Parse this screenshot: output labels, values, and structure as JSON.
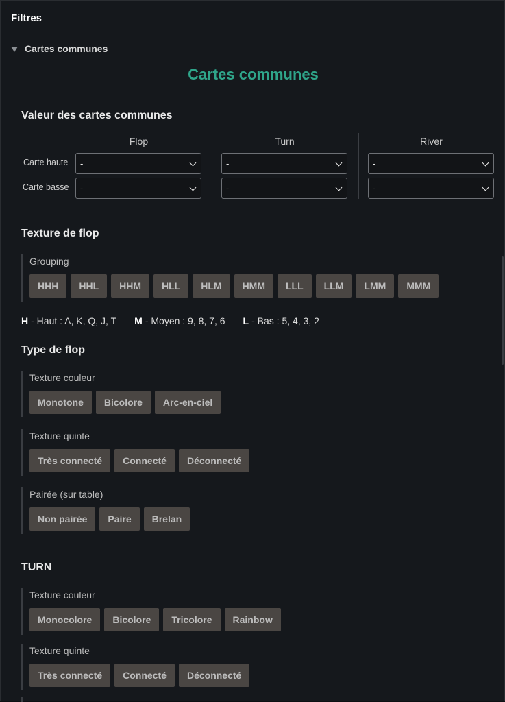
{
  "topbar": {
    "title": "Filtres"
  },
  "section": {
    "label": "Cartes communes"
  },
  "main_title": "Cartes communes",
  "board_value": {
    "title": "Valeur des cartes communes",
    "columns": [
      "Flop",
      "Turn",
      "River"
    ],
    "rows": [
      "Carte haute",
      "Carte basse"
    ],
    "selects": [
      [
        "-",
        "-",
        "-"
      ],
      [
        "-",
        "-",
        "-"
      ]
    ]
  },
  "flop_texture": {
    "title": "Texture de flop",
    "grouping_label": "Grouping",
    "grouping": [
      "HHH",
      "HHL",
      "HHM",
      "HLL",
      "HLM",
      "HMM",
      "LLL",
      "LLM",
      "LMM",
      "MMM"
    ],
    "legend": [
      {
        "key": "H",
        "text": "- Haut : A, K, Q, J, T"
      },
      {
        "key": "M",
        "text": "- Moyen : 9, 8, 7, 6"
      },
      {
        "key": "L",
        "text": "- Bas : 5, 4, 3, 2"
      }
    ]
  },
  "flop_type": {
    "title": "Type de flop",
    "color_label": "Texture couleur",
    "color": [
      "Monotone",
      "Bicolore",
      "Arc-en-ciel"
    ],
    "straight_label": "Texture quinte",
    "straight": [
      "Très connecté",
      "Connecté",
      "Déconnecté"
    ],
    "paired_label": "Pairée (sur table)",
    "paired": [
      "Non pairée",
      "Paire",
      "Brelan"
    ]
  },
  "turn": {
    "title": "TURN",
    "color_label": "Texture couleur",
    "color": [
      "Monocolore",
      "Bicolore",
      "Tricolore",
      "Rainbow"
    ],
    "straight_label": "Texture quinte",
    "straight": [
      "Très connecté",
      "Connecté",
      "Déconnecté"
    ]
  }
}
